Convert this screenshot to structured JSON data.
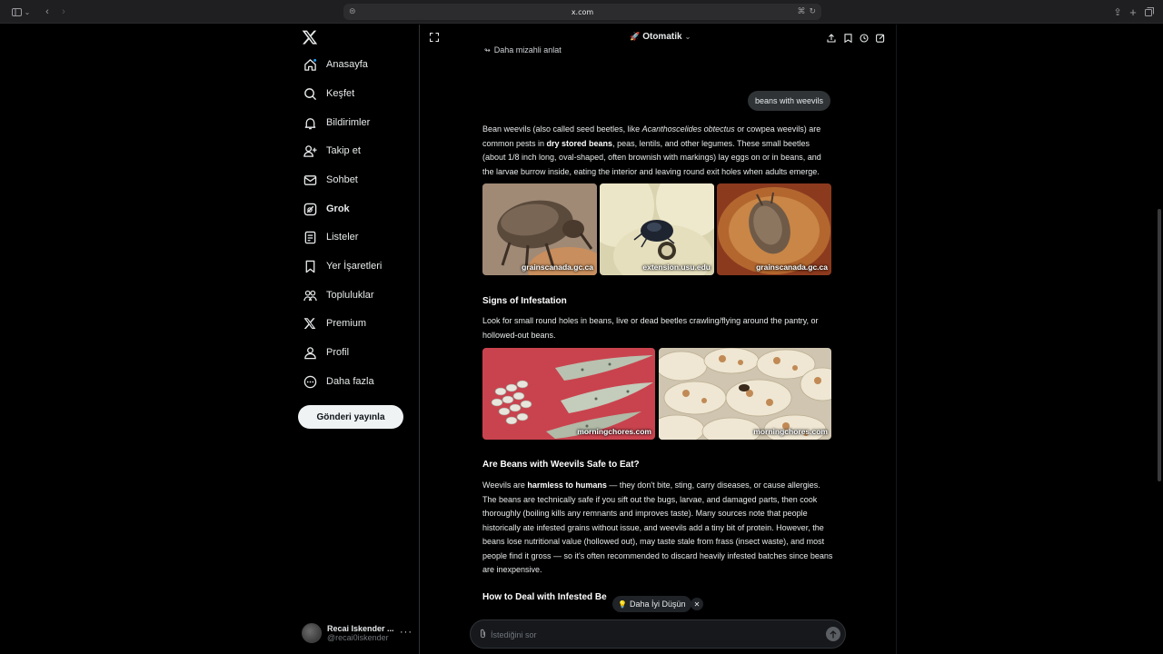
{
  "browser": {
    "url": "x.com"
  },
  "nav": {
    "items": [
      {
        "label": "Anasayfa",
        "icon": "home-icon"
      },
      {
        "label": "Keşfet",
        "icon": "search-icon"
      },
      {
        "label": "Bildirimler",
        "icon": "bell-icon"
      },
      {
        "label": "Takip et",
        "icon": "follow-icon"
      },
      {
        "label": "Sohbet",
        "icon": "mail-icon"
      },
      {
        "label": "Grok",
        "icon": "grok-icon"
      },
      {
        "label": "Listeler",
        "icon": "list-icon"
      },
      {
        "label": "Yer İşaretleri",
        "icon": "bookmark-icon"
      },
      {
        "label": "Topluluklar",
        "icon": "communities-icon"
      },
      {
        "label": "Premium",
        "icon": "x-premium-icon"
      },
      {
        "label": "Profil",
        "icon": "profile-icon"
      },
      {
        "label": "Daha fazla",
        "icon": "more-circle-icon"
      }
    ],
    "active_item": "Grok",
    "post_button": "Gönderi yayınla",
    "profile": {
      "name": "Recai Iskender ...",
      "handle": "@recai0iskender",
      "more": "···"
    }
  },
  "grok": {
    "mode": "Otomatik",
    "funny_link": "Daha mizahli anlat",
    "user_message": "beans with weevils",
    "intro": {
      "pre": "Bean weevils (also called seed beetles, like ",
      "italic": "Acanthoscelides obtectus",
      "mid": " or cowpea weevils) are common pests in ",
      "bold": "dry stored beans",
      "post": ", peas, lentils, and other legumes. These small beetles (about 1/8 inch long, oval-shaped, often brownish with markings) lay eggs on or in beans, and the larvae burrow inside, eating the interior and leaving round exit holes when adults emerge."
    },
    "images_row1": [
      {
        "source": "grainscanada.gc.ca"
      },
      {
        "source": "extension.usu.edu"
      },
      {
        "source": "grainscanada.gc.ca"
      }
    ],
    "signs_heading": "Signs of Infestation",
    "signs_text": "Look for small round holes in beans, live or dead beetles crawling/flying around the pantry, or hollowed-out beans.",
    "images_row2": [
      {
        "source": "morningchores.com"
      },
      {
        "source": "morningchores.com"
      }
    ],
    "safe_heading": "Are Beans with Weevils Safe to Eat?",
    "safe_text": {
      "pre": "Weevils are ",
      "bold": "harmless to humans",
      "post": " — they don't bite, sting, carry diseases, or cause allergies. The beans are technically safe if you sift out the bugs, larvae, and damaged parts, then cook thoroughly (boiling kills any remnants and improves taste). Many sources note that people historically ate infested grains without issue, and weevils add a tiny bit of protein. However, the beans lose nutritional value (hollowed out), may taste stale from frass (insect waste), and most people find it gross — so it's often recommended to discard heavily infested batches since beans are inexpensive."
    },
    "deal_heading": "How to Deal with Infested Be",
    "think_chip": "Daha İyi Düşün",
    "composer_placeholder": "İstediğini sor"
  }
}
